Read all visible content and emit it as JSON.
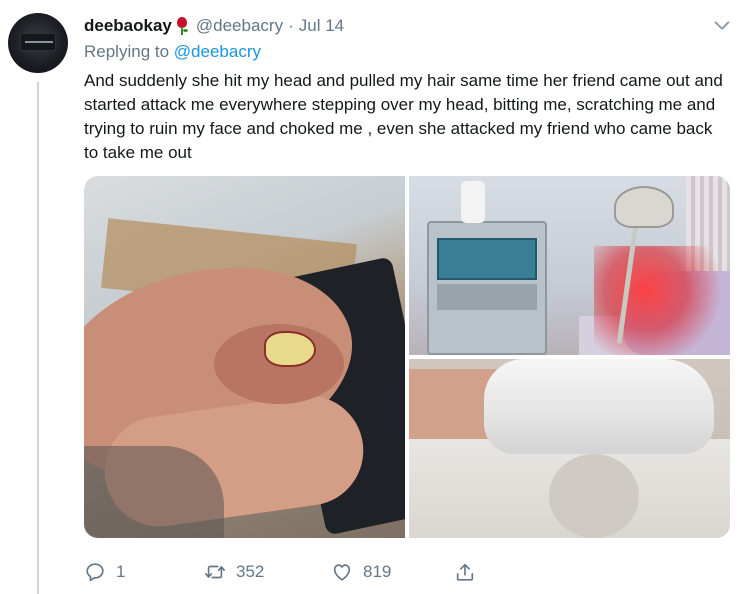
{
  "tweet": {
    "display_name": "deebaokay",
    "handle": "@deebacry",
    "separator": "·",
    "date": "Jul 14",
    "replying_prefix": "Replying to",
    "replying_to": "@deebacry",
    "text": "And suddenly she hit my head and pulled my hair same time her friend came out and started attack me everywhere  stepping over my head, bitting me, scratching me and trying to ruin my face and choked me , even she attacked my friend who came back to take me out"
  },
  "actions": {
    "replies": "1",
    "retweets": "352",
    "likes": "819"
  },
  "icons": {
    "name_emoji": "rose-icon",
    "menu": "chevron-down-icon",
    "reply": "reply-icon",
    "retweet": "retweet-icon",
    "like": "heart-icon",
    "share": "share-icon"
  },
  "colors": {
    "link": "#1b95e0",
    "secondary_text": "#657786",
    "primary_text": "#14171a",
    "thread_line": "#ccd6dd"
  }
}
